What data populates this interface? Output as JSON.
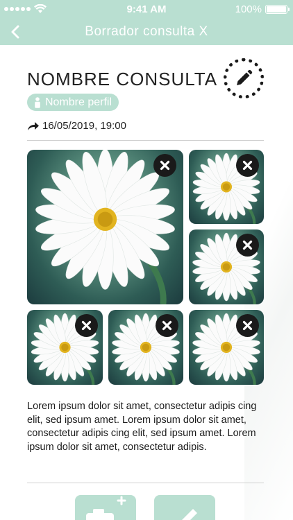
{
  "status_bar": {
    "time": "9:41 AM",
    "battery": "100%"
  },
  "nav": {
    "title": "Borrador consulta X"
  },
  "consulta": {
    "name": "NOMBRE CONSULTA",
    "profile": "Nombre perfil",
    "date": "16/05/2019, 19:00",
    "description": "Lorem ipsum dolor sit amet, consectetur adipis cing elit, sed ipsum amet. Lorem ipsum dolor sit amet, consectetur adipis cing elit, sed ipsum amet. Lorem ipsum dolor sit amet, consectetur adipis."
  },
  "photos": [
    {
      "subject": "daisy"
    },
    {
      "subject": "daisy"
    },
    {
      "subject": "daisy"
    },
    {
      "subject": "daisy"
    },
    {
      "subject": "daisy"
    },
    {
      "subject": "daisy"
    }
  ],
  "icons": {
    "back": "chevron-left-icon",
    "edit": "pencil-icon",
    "profile": "person-icon",
    "date": "share-arrow-icon",
    "remove": "close-icon",
    "add_photo": "camera-plus-icon",
    "write": "pencil-icon"
  },
  "colors": {
    "accent": "#b9dfd1",
    "text": "#1a1a1a",
    "remove_button": "#1a1a1a"
  }
}
